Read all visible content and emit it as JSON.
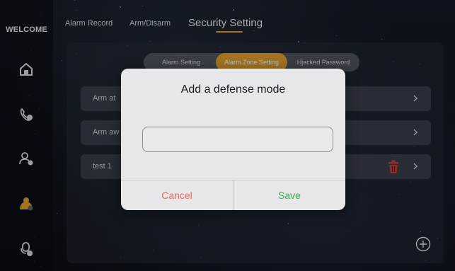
{
  "sidebar": {
    "welcome": "WELCOME",
    "icons": [
      "home-icon",
      "phone-call-icon",
      "users-icon",
      "security-icon",
      "intercom-icon"
    ],
    "active_color": "#e1a02f"
  },
  "top_tabs": [
    {
      "label": "Alarm Record"
    },
    {
      "label": "Arm/Disarm"
    },
    {
      "label": "Security Setting",
      "active": true
    }
  ],
  "segments": [
    {
      "label": "Alarm Setting"
    },
    {
      "label": "Alarm Zone Setting",
      "active": true
    },
    {
      "label": "Hjacked Password"
    }
  ],
  "rows": [
    {
      "label": "Arm at"
    },
    {
      "label": "Arm aw"
    },
    {
      "label": "test 1",
      "delete_icon": "trash-icon"
    }
  ],
  "dialog": {
    "title": "Add a defense mode",
    "input_value": "",
    "cancel_label": "Cancel",
    "save_label": "Save",
    "cancel_color": "#e26a6a",
    "save_color": "#3fa953"
  },
  "colors": {
    "accent": "#e1a02f",
    "delete": "#d23a3a"
  }
}
